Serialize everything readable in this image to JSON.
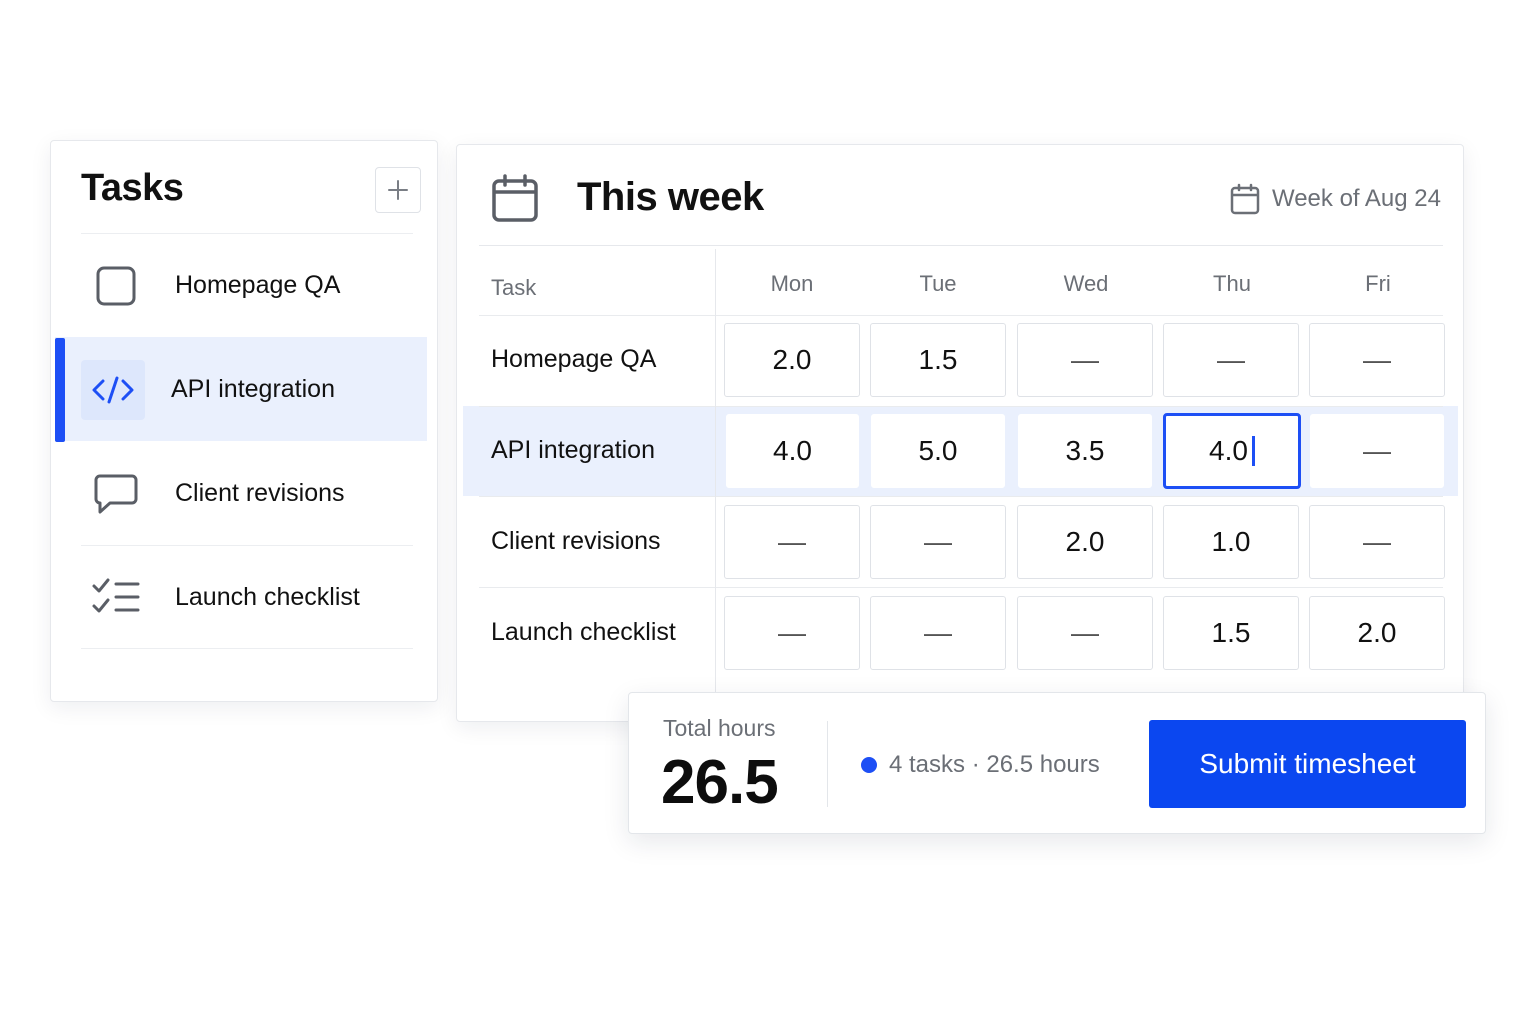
{
  "tasks_panel": {
    "title": "Tasks",
    "add_icon": "plus-icon",
    "items": [
      {
        "label": "Homepage QA",
        "icon": "checkbox-square-icon",
        "active": false
      },
      {
        "label": "API integration",
        "icon": "code-brackets-icon",
        "active": true
      },
      {
        "label": "Client revisions",
        "icon": "speech-bubble-icon",
        "active": false
      },
      {
        "label": "Launch checklist",
        "icon": "checklist-icon",
        "active": false
      }
    ]
  },
  "week_panel": {
    "title": "This week",
    "title_icon": "calendar-icon",
    "range_label": "Week of Aug 24",
    "columns": {
      "task": "Task",
      "days": [
        "Mon",
        "Tue",
        "Wed",
        "Thu",
        "Fri"
      ]
    },
    "rows": [
      {
        "task": "Homepage QA",
        "hours": [
          "2.0",
          "1.5",
          "—",
          "—",
          "—"
        ]
      },
      {
        "task": "API integration",
        "hours": [
          "4.0",
          "5.0",
          "3.5",
          "4.0",
          "—"
        ]
      },
      {
        "task": "Client revisions",
        "hours": [
          "—",
          "—",
          "2.0",
          "1.0",
          "—"
        ]
      },
      {
        "task": "Launch checklist",
        "hours": [
          "—",
          "—",
          "—",
          "1.5",
          "2.0"
        ]
      }
    ]
  },
  "footer": {
    "total_label": "Total hours",
    "total_value": "26.5",
    "summary": "4 tasks · 26.5 hours",
    "submit_label": "Submit timesheet"
  },
  "colors": {
    "accent": "#1d4ff5",
    "button": "#0b47f0",
    "active_row": "#eaf0fd",
    "muted_text": "#6b6f76"
  }
}
